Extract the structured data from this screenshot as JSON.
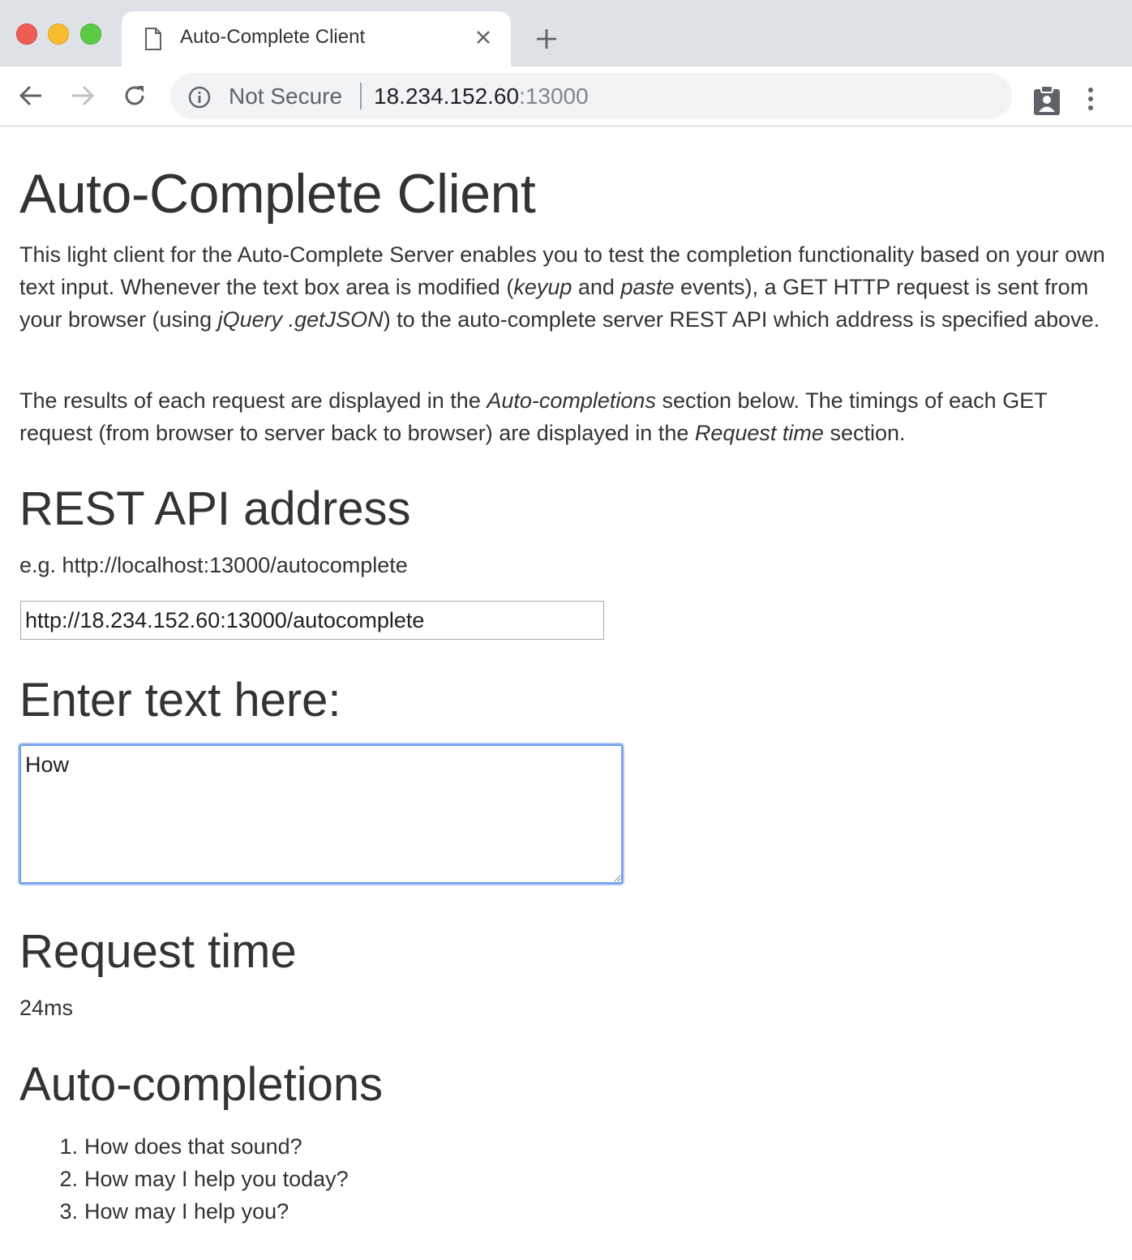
{
  "browser": {
    "tab": {
      "title": "Auto-Complete Client",
      "icon": "document-icon"
    },
    "address_bar": {
      "security_label": "Not Secure",
      "url_host": "18.234.152.60",
      "url_port": ":13000"
    }
  },
  "page": {
    "title": "Auto-Complete Client",
    "intro_paragraph_1": [
      {
        "text": "This light client for the Auto-Complete Server enables you to test the completion functionality based on your own text input. Whenever the text box area is modified (",
        "italic": false
      },
      {
        "text": "keyup",
        "italic": true
      },
      {
        "text": " and ",
        "italic": false
      },
      {
        "text": "paste",
        "italic": true
      },
      {
        "text": " events), a GET HTTP request is sent from your browser (using ",
        "italic": false
      },
      {
        "text": "jQuery .getJSON",
        "italic": true
      },
      {
        "text": ") to the auto-complete server REST API which address is specified above.",
        "italic": false
      }
    ],
    "intro_paragraph_2": [
      {
        "text": "The results of each request are displayed in the ",
        "italic": false
      },
      {
        "text": "Auto-completions",
        "italic": true
      },
      {
        "text": " section below. The timings of each GET request (from browser to server back to browser) are displayed in the ",
        "italic": false
      },
      {
        "text": "Request time",
        "italic": true
      },
      {
        "text": " section.",
        "italic": false
      }
    ],
    "rest_api": {
      "heading": "REST API address",
      "example": "e.g. http://localhost:13000/autocomplete",
      "input_value": "http://18.234.152.60:13000/autocomplete"
    },
    "enter_text": {
      "heading": "Enter text here:",
      "textarea_value": "How"
    },
    "request_time": {
      "heading": "Request time",
      "value": "24ms"
    },
    "auto_completions": {
      "heading": "Auto-completions",
      "items": [
        {
          "num": "1.",
          "text": "How does that sound?"
        },
        {
          "num": "2.",
          "text": "How may I help you today?"
        },
        {
          "num": "3.",
          "text": "How may I help you?"
        }
      ]
    }
  }
}
